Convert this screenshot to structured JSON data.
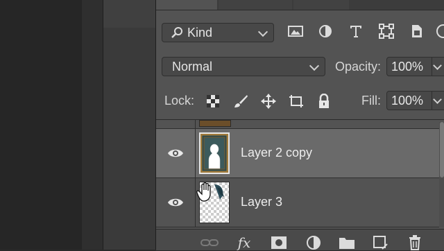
{
  "filter": {
    "kind_label": "Kind",
    "icons": [
      "image-filter-icon",
      "adjustment-filter-icon",
      "type-filter-icon",
      "shape-filter-icon",
      "smart-object-filter-icon",
      "filter-toggle-icon"
    ]
  },
  "blend": {
    "mode": "Normal",
    "opacity_label": "Opacity:",
    "opacity_value": "100%"
  },
  "lock": {
    "label": "Lock:",
    "icons": [
      "lock-transparent-pixels-icon",
      "lock-image-pixels-icon",
      "lock-position-icon",
      "lock-artboard-icon",
      "lock-all-icon"
    ],
    "fill_label": "Fill:",
    "fill_value": "100%"
  },
  "layers": [
    {
      "name": "Layer 2 copy",
      "visible": true,
      "selected": true
    },
    {
      "name": "Layer 3",
      "visible": true,
      "selected": false
    }
  ],
  "footer": {
    "icons": [
      "link-layers-icon",
      "layer-style-fx-icon",
      "add-mask-icon",
      "adjustment-layer-icon",
      "new-group-icon",
      "new-layer-icon",
      "delete-layer-icon"
    ],
    "fx_label": "fx"
  },
  "colors": {
    "panel_bg": "#535353",
    "selected_row": "#6a6a6a",
    "canvas_bg": "#262626"
  }
}
